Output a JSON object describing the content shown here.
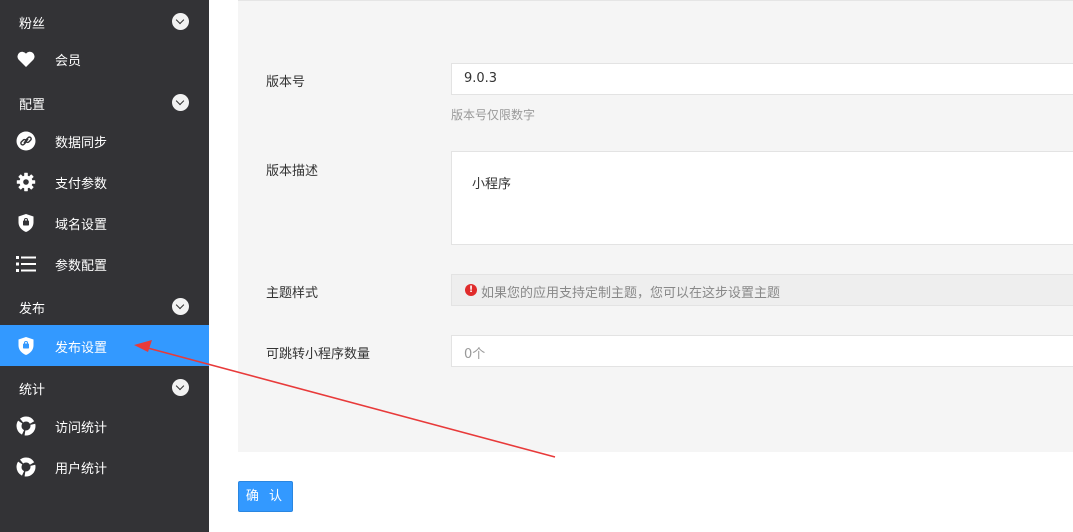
{
  "sidebar": {
    "groups": [
      {
        "label": "粉丝"
      },
      {
        "label": "配置"
      },
      {
        "label": "发布"
      },
      {
        "label": "统计"
      }
    ],
    "items": [
      {
        "label": "会员",
        "icon": "heart-icon"
      },
      {
        "label": "数据同步",
        "icon": "link-icon"
      },
      {
        "label": "支付参数",
        "icon": "gear-icon"
      },
      {
        "label": "域名设置",
        "icon": "shield-icon"
      },
      {
        "label": "参数配置",
        "icon": "list-icon"
      },
      {
        "label": "发布设置",
        "icon": "shield-icon",
        "active": true
      },
      {
        "label": "访问统计",
        "icon": "chart-ring-icon"
      },
      {
        "label": "用户统计",
        "icon": "chart-ring-icon"
      }
    ],
    "colors": {
      "background": "#333336",
      "active": "#3399ff"
    }
  },
  "form": {
    "version": {
      "label": "版本号",
      "value": "9.0.3",
      "hint": "版本号仅限数字"
    },
    "description": {
      "label": "版本描述",
      "value": "小程序"
    },
    "theme": {
      "label": "主题样式",
      "notice": "如果您的应用支持定制主题，您可以在这步设置主题"
    },
    "jump_count": {
      "label": "可跳转小程序数量",
      "placeholder": "0个"
    }
  },
  "submit_label": "确 认"
}
